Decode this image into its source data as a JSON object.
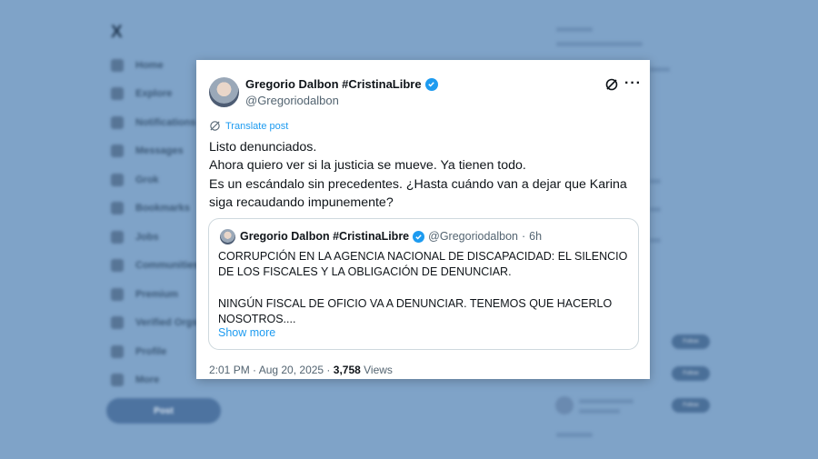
{
  "background": {
    "logo": "X",
    "nav": [
      "Home",
      "Explore",
      "Notifications",
      "Messages",
      "Grok",
      "Bookmarks",
      "Jobs",
      "Communities",
      "Premium",
      "Verified Orgs",
      "Profile",
      "More"
    ],
    "post_button": "Post",
    "follow_buttons": [
      "Follow",
      "Follow",
      "Follow"
    ]
  },
  "tweet": {
    "author_name": "Gregorio Dalbon #CristinaLibre",
    "author_handle": "@Gregoriodalbon",
    "translate_label": "Translate post",
    "text_lines": [
      "Listo denunciados.",
      "Ahora quiero ver si la justicia se mueve. Ya tienen todo.",
      "Es un escándalo sin precedentes. ¿Hasta cuándo van a dejar que Karina",
      "siga recaudando impunemente?"
    ],
    "quote": {
      "author_name": "Gregorio Dalbon #CristinaLibre",
      "author_handle": "@Gregoriodalbon",
      "separator": "·",
      "time": "6h",
      "lines": [
        "CORRUPCIÓN EN LA AGENCIA NACIONAL DE DISCAPACIDAD: EL SILENCIO",
        "DE LOS FISCALES Y LA OBLIGACIÓN DE DENUNCIAR.",
        "NINGÚN FISCAL DE OFICIO VA A DENUNCIAR. TENEMOS QUE HACERLO",
        "NOSOTROS...."
      ],
      "show_more": "Show more"
    },
    "timestamp": "2:01 PM · Aug 20, 2025 · ",
    "views_count": "3,758",
    "views_label": " Views"
  },
  "colors": {
    "accent": "#1d9bf0",
    "backdrop": "#7fa3c8"
  }
}
